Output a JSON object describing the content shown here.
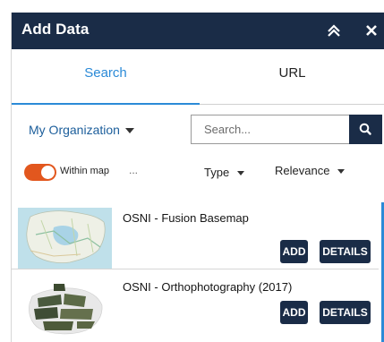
{
  "header": {
    "title": "Add Data",
    "collapse_icon": "double-chevron-up-icon",
    "close_icon": "close-icon"
  },
  "tabs": [
    {
      "label": "Search",
      "active": true
    },
    {
      "label": "URL",
      "active": false
    }
  ],
  "filters": {
    "scope": "My Organization",
    "search_placeholder": "Search...",
    "search_value": ""
  },
  "options": {
    "within_map": {
      "label": "Within map",
      "enabled": true
    },
    "more": "...",
    "type_label": "Type",
    "sort_label": "Relevance"
  },
  "results": [
    {
      "title": "OSNI - Fusion Basemap",
      "add_label": "ADD",
      "details_label": "DETAILS"
    },
    {
      "title": "OSNI - Orthophotography (2017)",
      "add_label": "ADD",
      "details_label": "DETAILS"
    }
  ],
  "colors": {
    "header_bg": "#1a2c47",
    "accent": "#2b8ad7",
    "toggle_on": "#e2571e"
  }
}
